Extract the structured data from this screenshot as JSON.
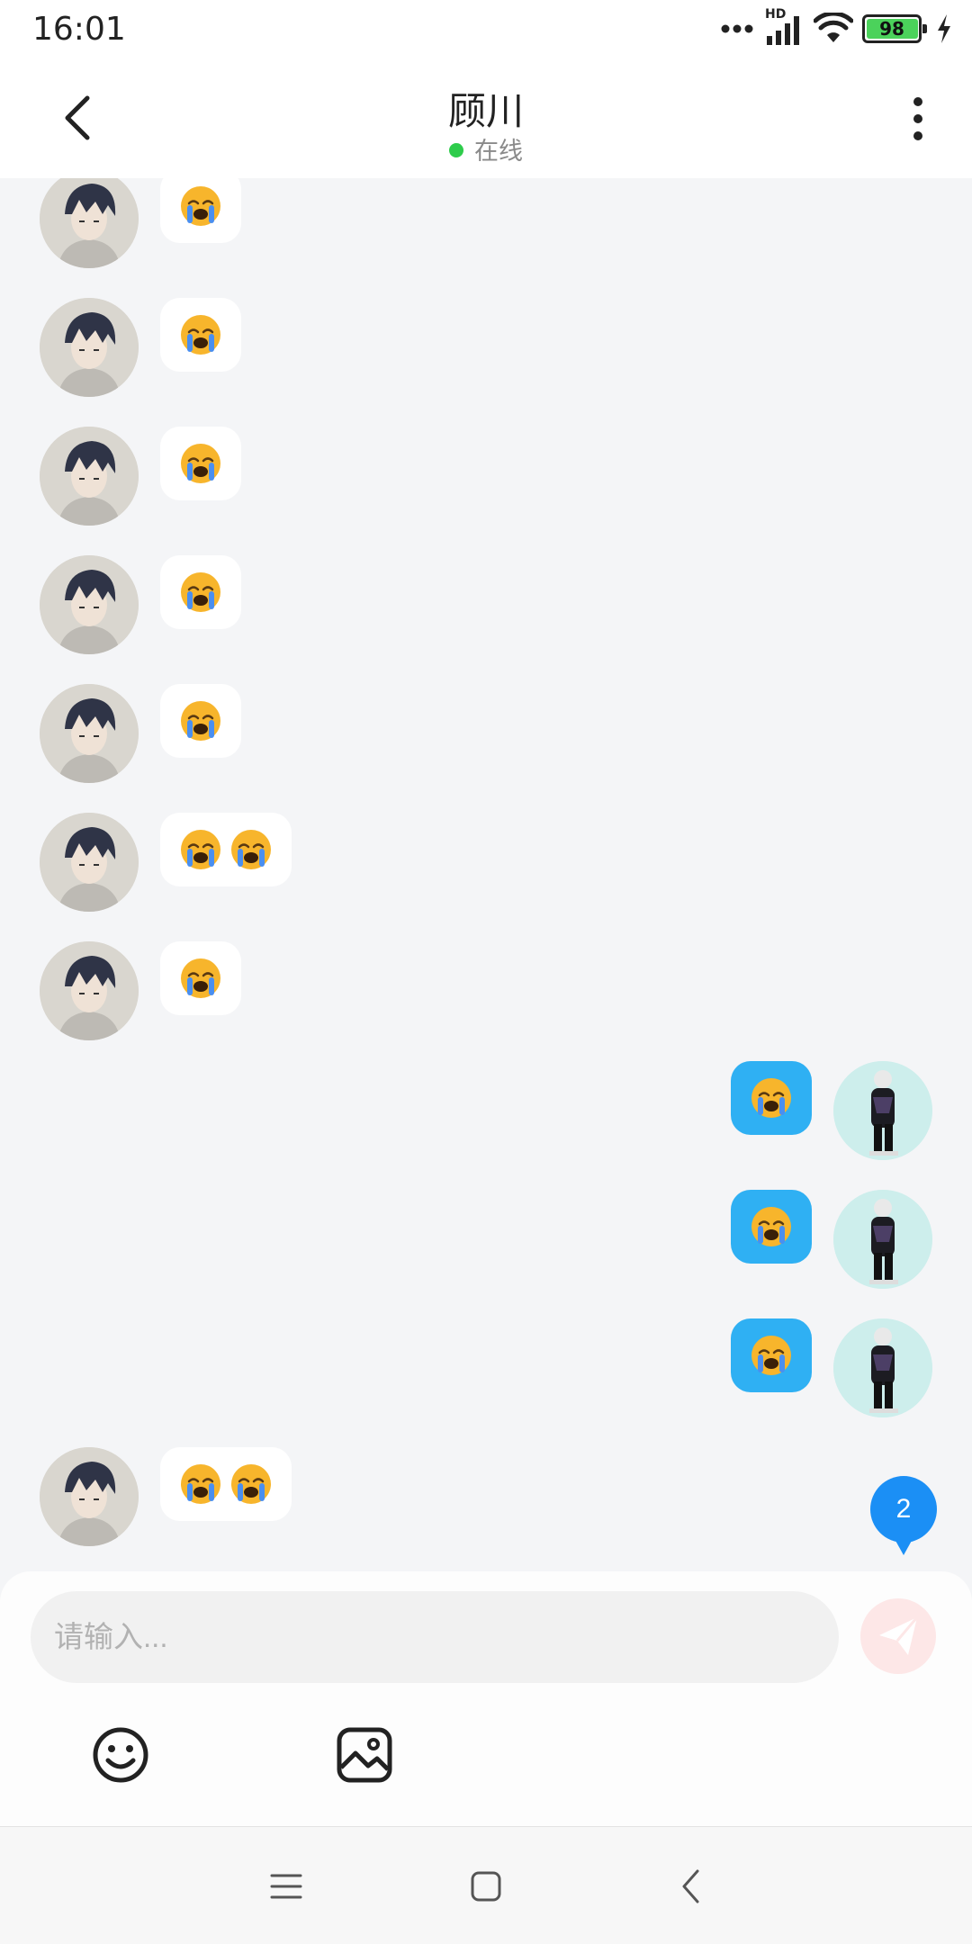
{
  "status_bar": {
    "time": "16:01",
    "battery_percent": 98,
    "battery_text": "98",
    "network_label": "HD",
    "icons": [
      "signal-dots-icon",
      "cellular-signal-icon",
      "wifi-icon",
      "battery-icon",
      "charging-bolt-icon"
    ]
  },
  "header": {
    "title": "顾川",
    "status": "在线",
    "status_color": "#2ecc4b",
    "back_icon": "chevron-left-icon",
    "more_icon": "more-vertical-icon"
  },
  "messages": [
    {
      "side": "left",
      "sender": "contact",
      "content": [
        "😭"
      ]
    },
    {
      "side": "left",
      "sender": "contact",
      "content": [
        "😭"
      ]
    },
    {
      "side": "left",
      "sender": "contact",
      "content": [
        "😭"
      ]
    },
    {
      "side": "left",
      "sender": "contact",
      "content": [
        "😭"
      ]
    },
    {
      "side": "left",
      "sender": "contact",
      "content": [
        "😭"
      ]
    },
    {
      "side": "left",
      "sender": "contact",
      "content": [
        "😭",
        "😭"
      ]
    },
    {
      "side": "left",
      "sender": "contact",
      "content": [
        "😭"
      ]
    },
    {
      "side": "right",
      "sender": "me",
      "content": [
        "😭"
      ]
    },
    {
      "side": "right",
      "sender": "me",
      "content": [
        "😭"
      ]
    },
    {
      "side": "right",
      "sender": "me",
      "content": [
        "😭"
      ]
    },
    {
      "side": "left",
      "sender": "contact",
      "content": [
        "😭",
        "😭"
      ]
    }
  ],
  "unread_badge": "2",
  "composer": {
    "placeholder": "请输入...",
    "send_icon": "paper-plane-icon",
    "tools": [
      "emoji-smile-icon",
      "image-icon"
    ]
  },
  "nav_bar": {
    "icons": [
      "menu-icon",
      "home-icon",
      "back-icon"
    ]
  },
  "colors": {
    "my_bubble": "#2fb0f3",
    "their_bubble": "#ffffff",
    "badge": "#1b8ff5",
    "background": "#f4f5f7"
  }
}
